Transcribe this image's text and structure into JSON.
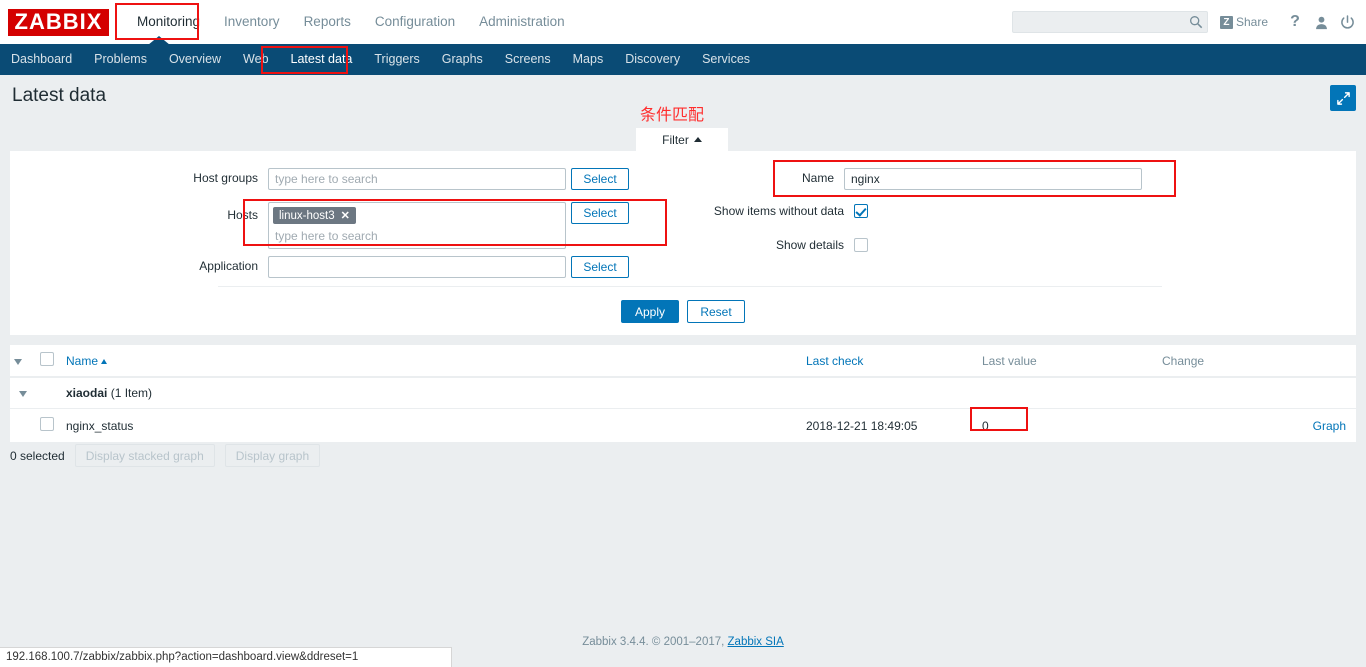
{
  "app": {
    "logo": "ZABBIX",
    "version_footer": "Zabbix 3.4.4. © 2001–2017, ",
    "footer_link": "Zabbix SIA",
    "status_url": "192.168.100.7/zabbix/zabbix.php?action=dashboard.view&ddreset=1"
  },
  "header": {
    "nav": [
      {
        "label": "Monitoring",
        "active": true
      },
      {
        "label": "Inventory",
        "active": false
      },
      {
        "label": "Reports",
        "active": false
      },
      {
        "label": "Configuration",
        "active": false
      },
      {
        "label": "Administration",
        "active": false
      }
    ],
    "search_placeholder": "",
    "search_value": "",
    "share_label": "Share",
    "share_mark": "Z",
    "help_label": "?",
    "icons": {
      "search": "search-icon",
      "user": "user-icon",
      "power": "power-icon"
    }
  },
  "subnav": {
    "items": [
      {
        "label": "Dashboard",
        "active": false
      },
      {
        "label": "Problems",
        "active": false
      },
      {
        "label": "Overview",
        "active": false
      },
      {
        "label": "Web",
        "active": false
      },
      {
        "label": "Latest data",
        "active": true
      },
      {
        "label": "Triggers",
        "active": false
      },
      {
        "label": "Graphs",
        "active": false
      },
      {
        "label": "Screens",
        "active": false
      },
      {
        "label": "Maps",
        "active": false
      },
      {
        "label": "Discovery",
        "active": false
      },
      {
        "label": "Services",
        "active": false
      }
    ]
  },
  "page": {
    "title": "Latest data",
    "kiosk_icon": "expand-icon"
  },
  "filter": {
    "tab_label": "Filter",
    "host_groups": {
      "label": "Host groups",
      "value": "",
      "placeholder": "type here to search",
      "select_label": "Select"
    },
    "hosts": {
      "label": "Hosts",
      "chips": [
        {
          "label": "linux-host3",
          "remove": "✕"
        }
      ],
      "placeholder": "type here to search",
      "select_label": "Select"
    },
    "application": {
      "label": "Application",
      "value": "",
      "placeholder": "",
      "select_label": "Select"
    },
    "name": {
      "label": "Name",
      "value": "nginx",
      "placeholder": ""
    },
    "show_without_data": {
      "label": "Show items without data",
      "checked": true
    },
    "show_details": {
      "label": "Show details",
      "checked": false
    },
    "apply_label": "Apply",
    "reset_label": "Reset"
  },
  "table": {
    "columns": [
      {
        "label": "Name",
        "sorted": true,
        "link": true
      },
      {
        "label": "Last check",
        "sorted": false,
        "link": true
      },
      {
        "label": "Last value",
        "sorted": false,
        "link": false
      },
      {
        "label": "Change",
        "sorted": false,
        "link": false
      },
      {
        "label": "",
        "sorted": false,
        "link": false
      }
    ],
    "group": {
      "name": "xiaodai",
      "count": "(1 Item)"
    },
    "rows": [
      {
        "name": "nginx_status",
        "last_check": "2018-12-21 18:49:05",
        "last_value": "0",
        "change": "",
        "action": "Graph"
      }
    ],
    "selected_text": "0 selected",
    "btn_stacked": "Display stacked graph",
    "btn_graph": "Display graph"
  },
  "annotations": {
    "chinese_note": "条件匹配",
    "color": "#ff2d2d"
  },
  "colors": {
    "brand_red": "#d40000",
    "nav_blue": "#0a4b75",
    "accent_blue": "#0275b8",
    "bg_gray": "#ebeef0",
    "chip_gray": "#6c7782"
  }
}
